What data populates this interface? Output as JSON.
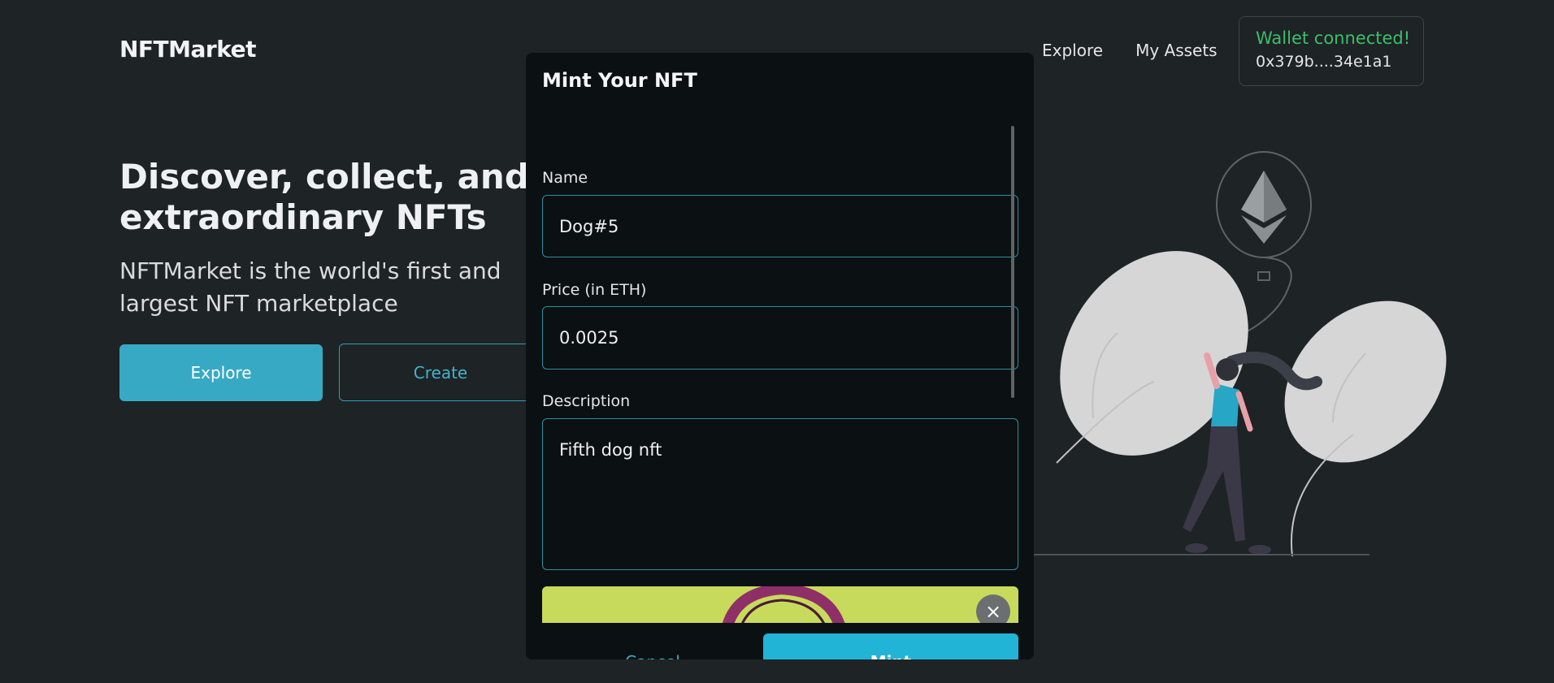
{
  "header": {
    "brand": "NFTMarket",
    "nav": [
      "Explore",
      "My Assets"
    ],
    "wallet_status": "Wallet connected!",
    "wallet_address": "0x379b....34e1a1"
  },
  "hero": {
    "title_line1": "Discover, collect, and se",
    "title_line2": "extraordinary NFTs",
    "subtitle_line1": "NFTMarket is the world's first and",
    "subtitle_line2": "largest NFT marketplace",
    "explore_label": "Explore",
    "create_label": "Create"
  },
  "modal": {
    "title": "Mint Your NFT",
    "name_label": "Name",
    "name_value": "Dog#5",
    "price_label": "Price (in ETH)",
    "price_value": "0.0025",
    "description_label": "Description",
    "description_value": "Fifth dog nft",
    "remove_icon": "×",
    "cancel_label": "Cancel",
    "mint_label": "Mint"
  },
  "colors": {
    "accent": "#22b4d6",
    "wallet_connected": "#3bbf6a",
    "background": "#1e2325",
    "modal_background": "#0b1012"
  }
}
